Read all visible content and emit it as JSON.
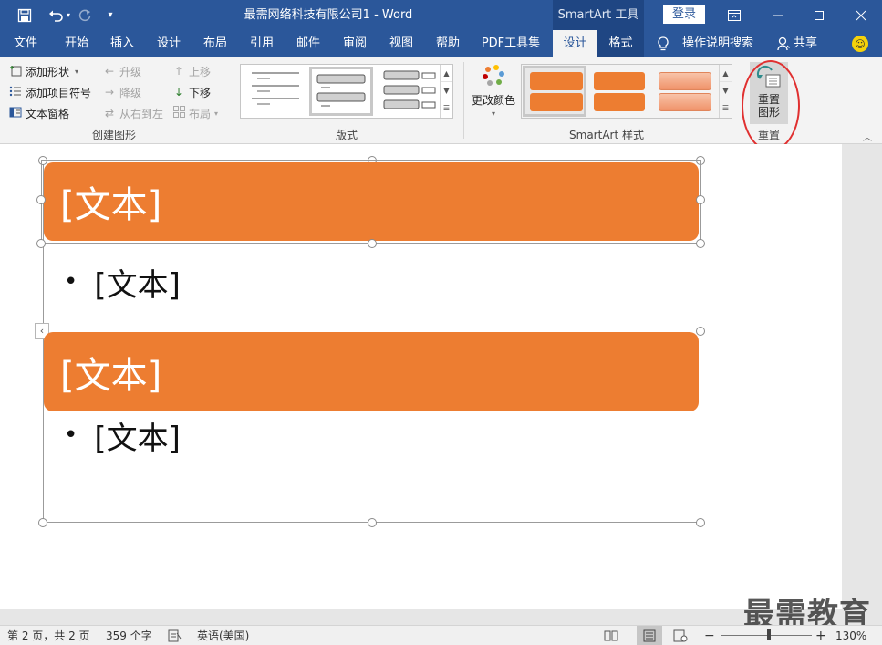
{
  "titlebar": {
    "document_title": "最需网络科技有限公司1  -  Word",
    "contextual_tools": "SmartArt 工具",
    "login_label": "登录",
    "icons": [
      "save-icon",
      "undo-icon",
      "redo-icon",
      "customize-qa-icon",
      "ribbon-display-icon",
      "minimize-icon",
      "maximize-icon",
      "close-icon"
    ]
  },
  "tabs": [
    {
      "label": "文件"
    },
    {
      "label": "开始"
    },
    {
      "label": "插入"
    },
    {
      "label": "设计"
    },
    {
      "label": "布局"
    },
    {
      "label": "引用"
    },
    {
      "label": "邮件"
    },
    {
      "label": "审阅"
    },
    {
      "label": "视图"
    },
    {
      "label": "帮助"
    },
    {
      "label": "PDF工具集"
    },
    {
      "label": "设计",
      "active": true
    },
    {
      "label": "格式"
    }
  ],
  "tell_me": "操作说明搜索",
  "share_label": "共享",
  "ribbon": {
    "create_graphic": {
      "label": "创建图形",
      "add_shape": "添加形状",
      "add_bullet": "添加项目符号",
      "text_pane": "文本窗格",
      "promote": "升级",
      "demote": "降级",
      "right_to_left": "从右到左",
      "move_up": "上移",
      "move_down": "下移",
      "layout": "布局"
    },
    "layouts": {
      "label": "版式"
    },
    "smartart_styles": {
      "label": "SmartArt 样式",
      "change_colors": "更改颜色"
    },
    "reset": {
      "label": "重置",
      "reset_graphic_line1": "重置",
      "reset_graphic_line2": "图形"
    }
  },
  "smartart": {
    "shape1_text": "[文本]",
    "bullet1_text": "[文本]",
    "shape2_text": "[文本]",
    "bullet2_text": "[文本]",
    "shape_color": "#ed7d31"
  },
  "watermark": "最需教育",
  "status": {
    "page": "第 2 页，共 2 页",
    "words": "359 个字",
    "language": "英语(美国)",
    "zoom": "130%"
  },
  "colors": {
    "ribbon_blue": "#2b579a",
    "tools_blue": "#1f4683",
    "accent_orange": "#ed7d31",
    "highlight_red": "#e03030"
  }
}
